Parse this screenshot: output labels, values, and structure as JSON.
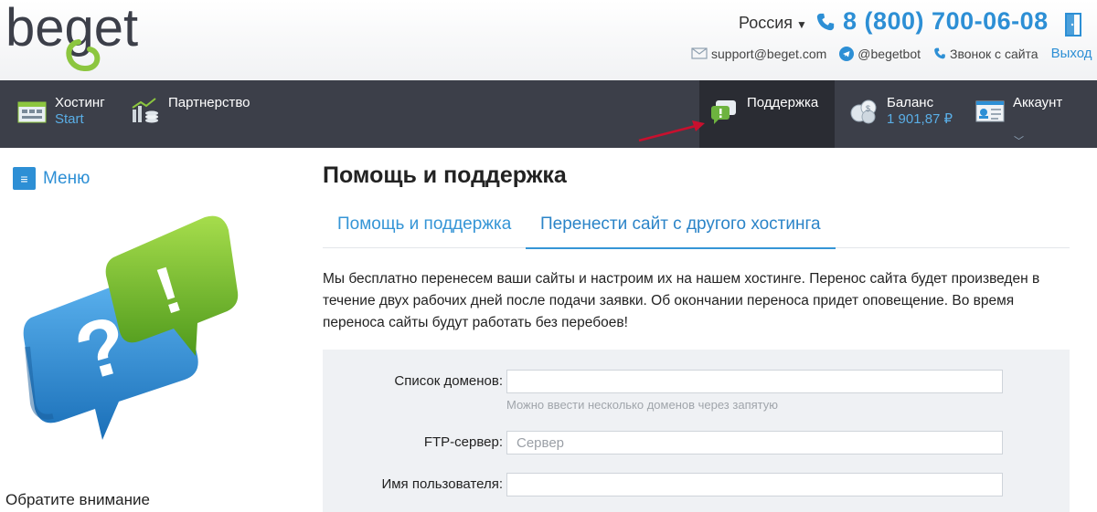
{
  "header": {
    "logo_text": "beget",
    "region": "Россия",
    "phone": "8 (800) 700-06-08",
    "email": "support@beget.com",
    "telegram": "@begetbot",
    "call": "Звонок с сайта",
    "exit": "Выход"
  },
  "nav": {
    "hosting_title": "Хостинг",
    "hosting_sub": "Start",
    "partner_title": "Партнерство",
    "support_title": "Поддержка",
    "balance_title": "Баланс",
    "balance_value": "1 901,87 ₽",
    "account_title": "Аккаунт"
  },
  "sidebar": {
    "menu_label": "Меню",
    "notice": "Обратите внимание"
  },
  "main": {
    "title": "Помощь и поддержка",
    "tabs": [
      {
        "label": "Помощь и поддержка",
        "active": false
      },
      {
        "label": "Перенести сайт с другого хостинга",
        "active": true
      }
    ],
    "description": "Мы бесплатно перенесем ваши сайты и настроим их на нашем хостинге. Перенос сайта будет произведен в течение двух рабочих дней после подачи заявки. Об окончании переноса придет оповещение. Во время переноса сайты будут работать без перебоев!"
  },
  "form": {
    "domains_label": "Список доменов:",
    "domains_value": "",
    "domains_hint": "Можно ввести несколько доменов через запятую",
    "ftp_label": "FTP-сервер:",
    "ftp_placeholder": "Сервер",
    "user_label": "Имя пользователя:",
    "user_value": ""
  },
  "colors": {
    "accent": "#2d8fd5",
    "nav_bg": "#3c3f49",
    "nav_active_bg": "#2a2c33",
    "form_bg": "#eff1f4"
  },
  "icons": [
    "envelope-icon",
    "telegram-icon",
    "phone-icon",
    "exit-door-icon",
    "hosting-icon",
    "partner-icon",
    "support-chat-icon",
    "balance-coins-icon",
    "account-card-icon",
    "menu-icon",
    "help-chat-illustration"
  ]
}
